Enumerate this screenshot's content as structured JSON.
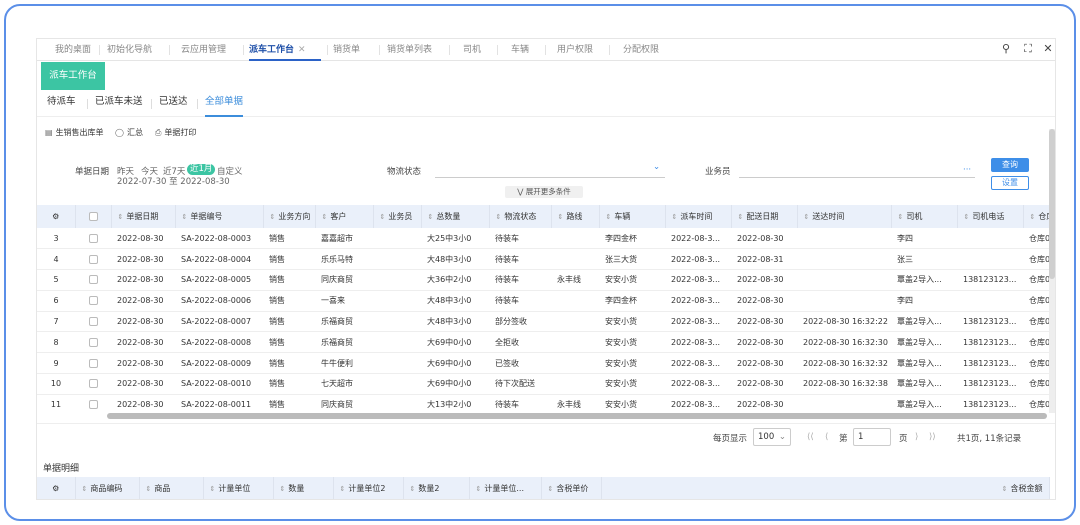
{
  "tabs": [
    {
      "label": "我的桌面"
    },
    {
      "label": "初始化导航"
    },
    {
      "label": "云应用管理"
    },
    {
      "label": "派车工作台",
      "active": true,
      "close": "✕"
    },
    {
      "label": "销货单"
    },
    {
      "label": "销货单列表"
    },
    {
      "label": "司机"
    },
    {
      "label": "车辆"
    },
    {
      "label": "用户权限"
    },
    {
      "label": "分配权限"
    }
  ],
  "window_icons": [
    "search-icon",
    "fullscreen-icon",
    "close-icon"
  ],
  "page_badge": "派车工作台",
  "subtabs": [
    {
      "label": "待派车"
    },
    {
      "label": "已派车未送"
    },
    {
      "label": "已送达"
    },
    {
      "label": "全部单据",
      "active": true
    }
  ],
  "tools": [
    {
      "icon": "document-icon",
      "label": "生销售出库单"
    },
    {
      "icon": "summary-icon",
      "label": "汇总"
    },
    {
      "icon": "print-icon",
      "label": "单据打印"
    }
  ],
  "filters": {
    "date_label": "单据日期",
    "date_options": [
      "昨天",
      "今天",
      "近7天",
      "近1月",
      "自定义"
    ],
    "date_selected": "近1月",
    "date_range": "2022-07-30 至 2022-08-30",
    "logistics_label": "物流状态",
    "salesman_label": "业务员",
    "salesman_more": "···",
    "expand_label": "展开更多条件",
    "query_button": "查询",
    "settings_button": "设置"
  },
  "columns": [
    "单据日期",
    "单据编号",
    "业务方向",
    "客户",
    "业务员",
    "总数量",
    "物流状态",
    "路线",
    "车辆",
    "派车时间",
    "配送日期",
    "送达时间",
    "司机",
    "司机电话",
    "仓库"
  ],
  "rows": [
    [
      "3",
      "2022-08-30",
      "SA-2022-08-0003",
      "销售",
      "嘉嘉超市",
      "",
      "大25中3小0",
      "待装车",
      "",
      "李四金杯",
      "2022-08-3...",
      "2022-08-30",
      "",
      "李四",
      "",
      "仓库01"
    ],
    [
      "4",
      "2022-08-30",
      "SA-2022-08-0004",
      "销售",
      "乐乐马特",
      "",
      "大48中3小0",
      "待装车",
      "",
      "张三大货",
      "2022-08-3...",
      "2022-08-31",
      "",
      "张三",
      "",
      "仓库01"
    ],
    [
      "5",
      "2022-08-30",
      "SA-2022-08-0005",
      "销售",
      "同庆商贸",
      "",
      "大36中2小0",
      "待装车",
      "永丰线",
      "安安小货",
      "2022-08-3...",
      "2022-08-30",
      "",
      "覃盖2导入...",
      "138123123...",
      "仓库01"
    ],
    [
      "6",
      "2022-08-30",
      "SA-2022-08-0006",
      "销售",
      "一喜来",
      "",
      "大48中3小0",
      "待装车",
      "",
      "李四金杯",
      "2022-08-3...",
      "2022-08-30",
      "",
      "李四",
      "",
      "仓库01"
    ],
    [
      "7",
      "2022-08-30",
      "SA-2022-08-0007",
      "销售",
      "乐福商贸",
      "",
      "大48中3小0",
      "部分签收",
      "",
      "安安小货",
      "2022-08-3...",
      "2022-08-30",
      "2022-08-30 16:32:22",
      "覃盖2导入...",
      "138123123...",
      "仓库01"
    ],
    [
      "8",
      "2022-08-30",
      "SA-2022-08-0008",
      "销售",
      "乐福商贸",
      "",
      "大69中0小0",
      "全拒收",
      "",
      "安安小货",
      "2022-08-3...",
      "2022-08-30",
      "2022-08-30 16:32:30",
      "覃盖2导入...",
      "138123123...",
      "仓库01"
    ],
    [
      "9",
      "2022-08-30",
      "SA-2022-08-0009",
      "销售",
      "牛牛便利",
      "",
      "大69中0小0",
      "已签收",
      "",
      "安安小货",
      "2022-08-3...",
      "2022-08-30",
      "2022-08-30 16:32:32",
      "覃盖2导入...",
      "138123123...",
      "仓库01"
    ],
    [
      "10",
      "2022-08-30",
      "SA-2022-08-0010",
      "销售",
      "七天超市",
      "",
      "大69中0小0",
      "待下次配送",
      "",
      "安安小货",
      "2022-08-3...",
      "2022-08-30",
      "2022-08-30 16:32:38",
      "覃盖2导入...",
      "138123123...",
      "仓库01"
    ],
    [
      "11",
      "2022-08-30",
      "SA-2022-08-0011",
      "销售",
      "同庆商贸",
      "",
      "大13中2小0",
      "待装车",
      "永丰线",
      "安安小货",
      "2022-08-3...",
      "2022-08-30",
      "",
      "覃盖2导入...",
      "138123123...",
      "仓库01"
    ]
  ],
  "pager": {
    "per_page_label": "每页显示",
    "per_page": "100",
    "page_label_pre": "第",
    "page": "1",
    "page_label_post": "页",
    "summary": "共1页, 11条记录"
  },
  "detail": {
    "title": "单据明细",
    "columns": [
      "商品编码",
      "商品",
      "计量单位",
      "数量",
      "计量单位2",
      "数量2",
      "计量单位...",
      "含税单价",
      "含税金额"
    ]
  },
  "colors": {
    "accent": "#3cc5a3",
    "blue": "#3e8ee8",
    "header_bg": "#eaf0fa"
  }
}
